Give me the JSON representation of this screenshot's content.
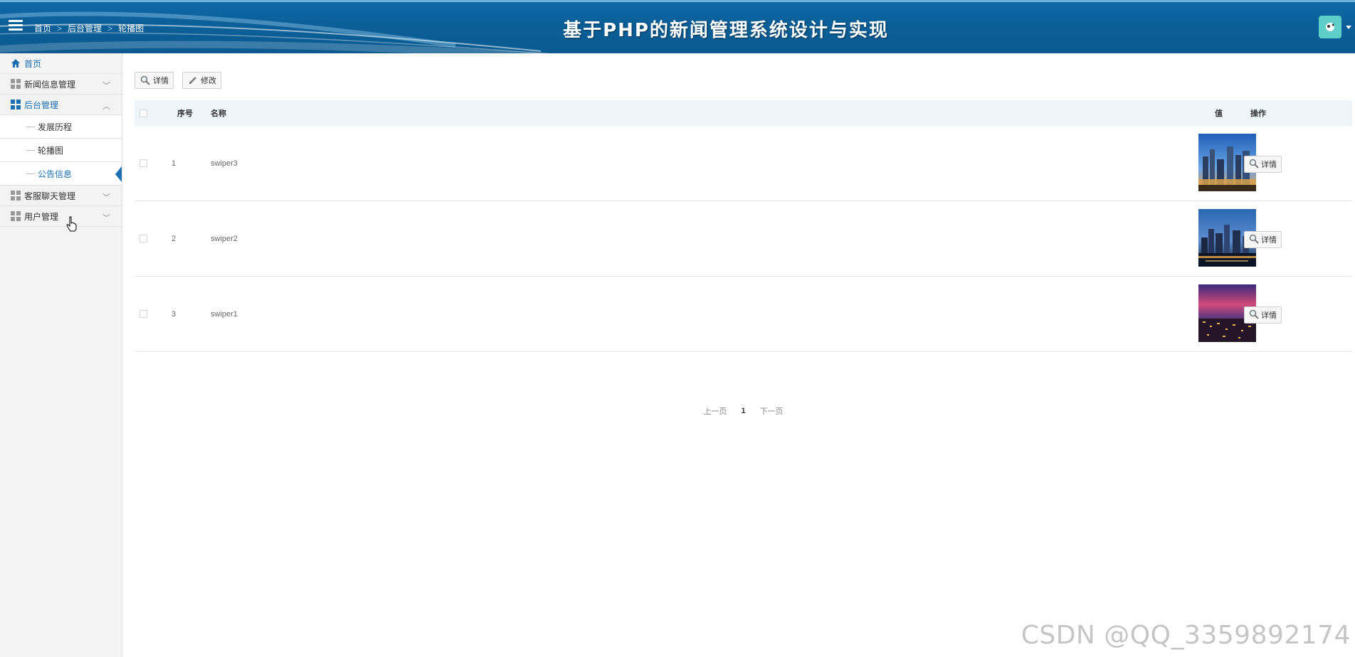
{
  "header": {
    "title": "基于PHP的新闻管理系统设计与实现",
    "breadcrumb": [
      "首页",
      "后台管理",
      "轮播图"
    ]
  },
  "sidebar": {
    "home": "首页",
    "items": [
      {
        "label": "新闻信息管理"
      },
      {
        "label": "后台管理"
      },
      {
        "label": "客服聊天管理"
      },
      {
        "label": "用户管理"
      }
    ],
    "sub_items": [
      "发展历程",
      "轮播图",
      "公告信息"
    ]
  },
  "toolbar": {
    "detail_label": "详情",
    "edit_label": "修改"
  },
  "table": {
    "headers": {
      "index": "序号",
      "name": "名称",
      "value": "值",
      "action": "操作"
    },
    "rows": [
      {
        "index": "1",
        "name": "swiper3",
        "action": "详情"
      },
      {
        "index": "2",
        "name": "swiper2",
        "action": "详情"
      },
      {
        "index": "3",
        "name": "swiper1",
        "action": "详情"
      }
    ]
  },
  "pagination": {
    "prev": "上一页",
    "current": "1",
    "next": "下一页"
  },
  "watermark": "CSDN @QQ_3359892174",
  "colors": {
    "header_bg": "#0b5f98",
    "accent": "#1a6fb0",
    "avatar_bg": "#5ecfc8",
    "table_head_bg": "#eef5f9"
  }
}
